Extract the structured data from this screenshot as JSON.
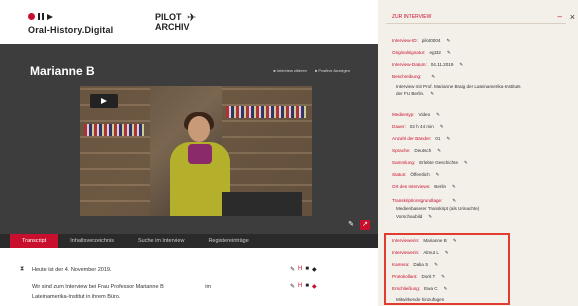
{
  "brand": {
    "logo_text": "Oral-History.Digital",
    "pilot_line1": "PILOT",
    "pilot_line2": "ARCHIV"
  },
  "interview": {
    "name": "Marianne B"
  },
  "stage_links": [
    "Interview zitieren",
    "Positive Anzeigen"
  ],
  "tabs": [
    "Transcript",
    "Inhaltsverzeichnis",
    "Suche im Interview",
    "Registereinträge"
  ],
  "transcript": {
    "line1": "Heute ist der 4. November 2019.",
    "line2_a": "Wir sind zum Interview bei Frau Professor Marianne B",
    "line2_b": "im",
    "line3": "Lateinamerika-Institut in ihrem Büro."
  },
  "sidebar": {
    "section_title": "ZUR INTERVIEW",
    "fields": [
      {
        "k": "Interview-ID:",
        "v": "pilot0004"
      },
      {
        "k": "Originalsignatur:",
        "v": "egt32"
      },
      {
        "k": "Interview-Datum:",
        "v": "04.11.2019"
      },
      {
        "k": "Beschreibung:",
        "v": ""
      },
      {
        "k": "",
        "v": "Interview mit Prof. Marianne Braig der Lateinamerika-Instituts"
      },
      {
        "k": "",
        "v": "der FU Berlin."
      },
      {
        "k": "Medientyp:",
        "v": "Video"
      },
      {
        "k": "Dauer:",
        "v": "02 h 44 min"
      },
      {
        "k": "Anzahl der Bänder:",
        "v": "01"
      },
      {
        "k": "Sprache:",
        "v": "Deutsch"
      },
      {
        "k": "Sammlung:",
        "v": "Erlebte Geschichte"
      },
      {
        "k": "Status:",
        "v": "Öffentlich"
      },
      {
        "k": "Ort des Interviews:",
        "v": "Berlin"
      },
      {
        "k": "Transkriptionsgrundlage:",
        "v": ""
      },
      {
        "k": "",
        "v": "Medienbaserer    Transkript (als Urinachte)"
      },
      {
        "k": "",
        "v": "Vorschaubild"
      },
      {
        "k": "Interviewerin:",
        "v": "Marianne B"
      },
      {
        "k": "Interviewerin:",
        "v": "Almut L"
      },
      {
        "k": "Kamera:",
        "v": "Dalia S"
      },
      {
        "k": "Protokollant:",
        "v": "Dorit T"
      },
      {
        "k": "Erschließung:",
        "v": "Ewa C"
      },
      {
        "k": "",
        "v": "Mitwirkende hinzufügen"
      }
    ]
  }
}
